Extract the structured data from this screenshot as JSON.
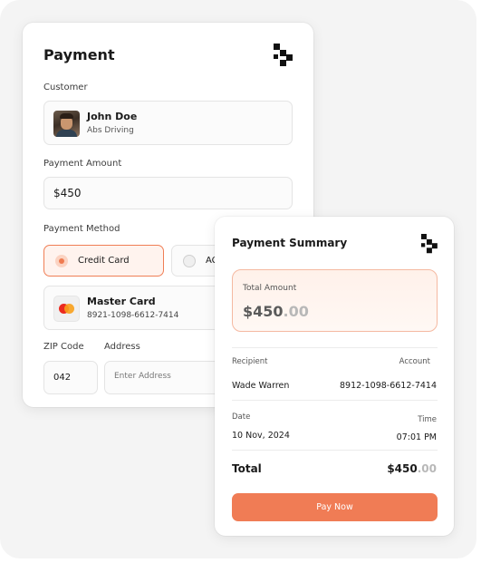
{
  "payment": {
    "title": "Payment",
    "customer_label": "Customer",
    "customer": {
      "name": "John Doe",
      "subtitle": "Abs Driving"
    },
    "amount_label": "Payment Amount",
    "amount_value": "$450",
    "method_label": "Payment Method",
    "methods": [
      {
        "label": "Credit Card",
        "selected": true
      },
      {
        "label": "AC",
        "selected": false
      }
    ],
    "card": {
      "name": "Master Card",
      "number": "8921-1098-6612-7414"
    },
    "zip_label": "ZIP Code",
    "zip_value": "042",
    "address_label": "Address",
    "address_placeholder": "Enter Address"
  },
  "summary": {
    "title": "Payment Summary",
    "total_label": "Total Amount",
    "total_whole": "$450",
    "total_decimal": ".00",
    "recipient_label": "Recipient",
    "recipient_value": "Wade Warren",
    "account_label": "Account",
    "account_value": "8912-1098-6612-7414",
    "date_label": "Date",
    "date_value": "10 Nov, 2024",
    "time_label": "Time",
    "time_value": "07:01 PM",
    "grand_label": "Total",
    "grand_whole": "$450",
    "grand_decimal": ".00",
    "pay_button": "Pay Now"
  },
  "icons": {
    "brand_logo": "brand-logo-icon",
    "avatar": "avatar",
    "mastercard": "mastercard-icon"
  },
  "colors": {
    "accent": "#f07c55",
    "accent_light": "#fff3ee",
    "backdrop": "#f4f4f4"
  }
}
